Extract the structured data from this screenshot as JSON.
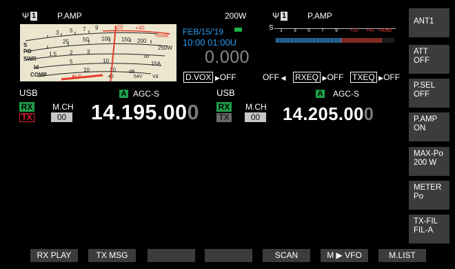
{
  "main": {
    "ant_label": "1",
    "preamp": "P.AMP",
    "power": "200W"
  },
  "sub": {
    "ant_label": "1",
    "preamp": "P.AMP"
  },
  "meter": {
    "s_scale": [
      "S",
      "1",
      "3",
      "5",
      "7",
      "9",
      "+20",
      "+40",
      "+60dB"
    ],
    "po_scale": [
      "PO",
      "0",
      "5",
      "10",
      "25",
      "50",
      "100",
      "150",
      "200",
      "250W"
    ],
    "swr_scale": [
      "SWR",
      "1",
      "1.5",
      "2",
      "3",
      "∞"
    ],
    "id_scale": [
      "Id",
      "0",
      "5",
      "10",
      "15A"
    ],
    "comp_scale": [
      "COMP",
      "0",
      "10",
      "20",
      "dB"
    ],
    "alc_label": "ALC",
    "vd_scale": [
      "46",
      "54V",
      "Vd"
    ],
    "needle_position": 0.52
  },
  "status": {
    "date": "FEB/15/'19",
    "time": "10:00 01:00U",
    "offset_value": "0.000",
    "dvox_label": "D.VOX",
    "dvox_value": "OFF",
    "rx_filter_state": "OFF",
    "rxeq_label": "RXEQ",
    "rxeq_value": "OFF",
    "txeq_label": "TXEQ",
    "txeq_value": "OFF"
  },
  "bar_meter": {
    "s_label": "S",
    "ticks": [
      "1",
      "3",
      "5",
      "7",
      "9",
      "+20",
      "+40",
      "+60dB"
    ],
    "level_fraction": 0.9
  },
  "vfo_main": {
    "mode": "USB",
    "vfo": "A",
    "agc": "AGC-S",
    "rx": "RX",
    "tx": "TX",
    "mch_label": "M.CH",
    "mch_value": "00",
    "freq_main": "14.195.00",
    "freq_dim": "0"
  },
  "vfo_sub": {
    "mode": "USB",
    "vfo": "A",
    "agc": "AGC-S",
    "rx": "RX",
    "tx": "TX",
    "mch_label": "M.CH",
    "mch_value": "00",
    "freq_main": "14.205.00",
    "freq_dim": "0"
  },
  "right_keys": [
    {
      "line1": "ANT1",
      "line2": ""
    },
    {
      "line1": "ATT",
      "line2": "OFF"
    },
    {
      "line1": "P.SEL",
      "line2": "OFF"
    },
    {
      "line1": "P.AMP",
      "line2": "ON"
    },
    {
      "line1": "MAX-Po",
      "line2": "200 W"
    },
    {
      "line1": "METER",
      "line2": "Po"
    },
    {
      "line1": "TX-FIL",
      "line2": "FIL-A"
    }
  ],
  "bottom_keys": [
    "RX PLAY",
    "TX MSG",
    "",
    "",
    "SCAN",
    "M ▶ VFO",
    "M.LIST"
  ],
  "colors": {
    "accent_blue": "#2a9df4",
    "rx_green": "#1fa04a",
    "tx_red": "#d8202a",
    "meter_face": "#ece6cf",
    "red_scale": "#e23a2a"
  }
}
